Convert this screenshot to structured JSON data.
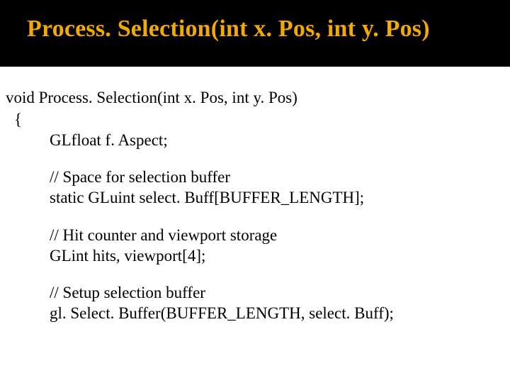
{
  "title": "Process. Selection(int x. Pos, int y. Pos)",
  "code": {
    "sig": "void Process. Selection(int x. Pos, int y. Pos)",
    "brace": "{",
    "l1": "GLfloat f. Aspect;",
    "c1": "// Space for selection buffer",
    "l2": "static GLuint select. Buff[BUFFER_LENGTH];",
    "c2": "// Hit counter and viewport storage",
    "l3": "GLint hits, viewport[4];",
    "c3": "// Setup selection buffer",
    "l4": "gl. Select. Buffer(BUFFER_LENGTH, select. Buff);"
  }
}
